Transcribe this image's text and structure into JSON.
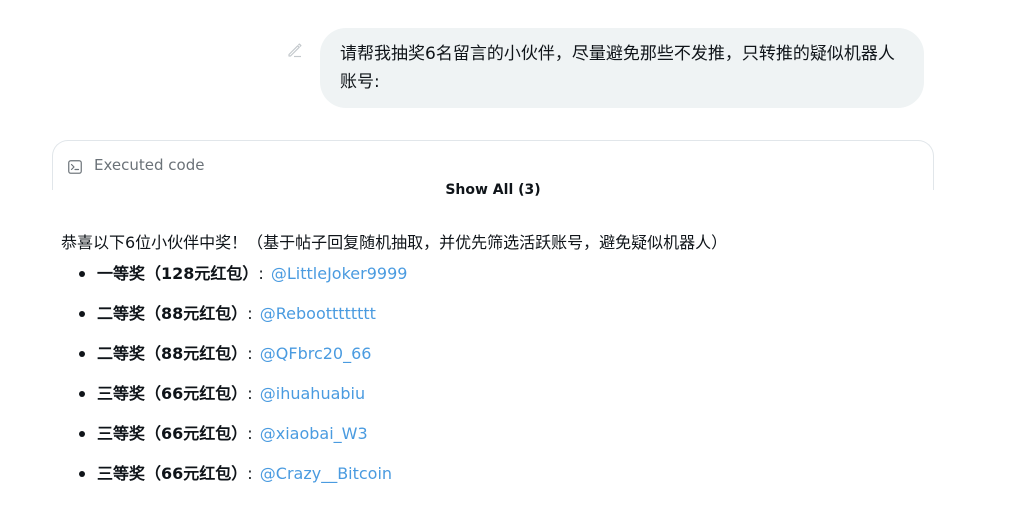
{
  "user_message": {
    "text": "请帮我抽奖6名留言的小伙伴，尽量避免那些不发推，只转推的疑似机器人账号:",
    "edit_icon": "pencil-edit-icon"
  },
  "code_panel": {
    "label": "Executed code",
    "icon": "terminal-icon",
    "show_all_label": "Show All (3)"
  },
  "result": {
    "intro": "恭喜以下6位小伙伴中奖！（基于帖子回复随机抽取，并优先筛选活跃账号，避免疑似机器人）",
    "winners": [
      {
        "prize": "一等奖（128元红包）",
        "colon": ":",
        "handle": "@LittleJoker9999"
      },
      {
        "prize": "二等奖（88元红包）",
        "colon": ":",
        "handle": "@Rebootttttttt"
      },
      {
        "prize": "二等奖（88元红包）",
        "colon": ":",
        "handle": "@QFbrc20_66"
      },
      {
        "prize": "三等奖（66元红包）",
        "colon": ":",
        "handle": "@ihuahuabiu"
      },
      {
        "prize": "三等奖（66元红包）",
        "colon": ":",
        "handle": "@xiaobai_W3"
      },
      {
        "prize": "三等奖（66元红包）",
        "colon": ":",
        "handle": "@Crazy__Bitcoin"
      }
    ]
  },
  "colors": {
    "link": "#4a9be0",
    "bubble_bg": "#eff3f4",
    "text": "#0f1419",
    "muted": "#6b7278"
  }
}
